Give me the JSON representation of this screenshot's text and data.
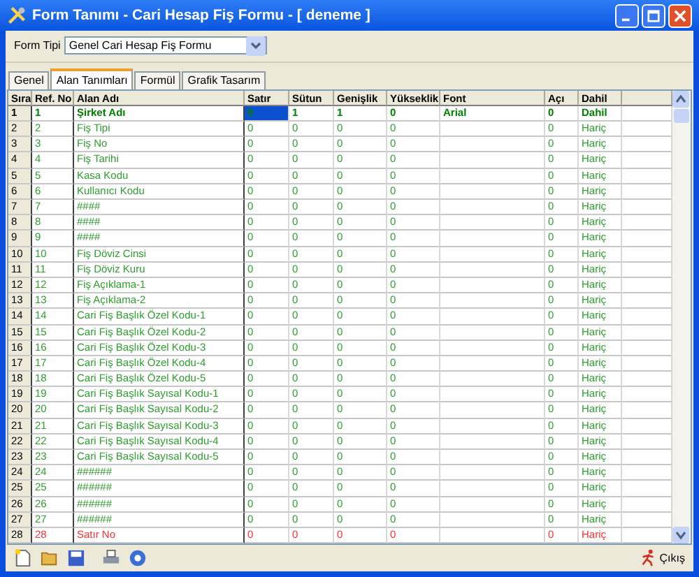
{
  "window": {
    "title": "Form Tanımı - Cari Hesap Fiş Formu - [ deneme ]"
  },
  "form_type": {
    "label": "Form Tipi",
    "value": "Genel Cari Hesap Fiş Formu"
  },
  "tabs": [
    {
      "label": "Genel",
      "selected": false
    },
    {
      "label": "Alan Tanımları",
      "selected": true
    },
    {
      "label": "Formül",
      "selected": false
    },
    {
      "label": "Grafik Tasarım",
      "selected": false
    }
  ],
  "table": {
    "columns": [
      "Sıra",
      "Ref. No",
      "Alan Adı",
      "Satır",
      "Sütun",
      "Genişlik",
      "Yükseklik",
      "Font",
      "Açı",
      "Dahil"
    ],
    "rows": [
      {
        "sira": "1",
        "ref": "1",
        "name": "Şirket Adı",
        "satir": "0",
        "sutun": "1",
        "genislik": "1",
        "yukseklik": "0",
        "font": "Arial",
        "aci": "0",
        "dahil": "Dahil",
        "bold": true,
        "selected": true,
        "color": "#008000"
      },
      {
        "sira": "2",
        "ref": "2",
        "name": "Fiş Tipi",
        "satir": "0",
        "sutun": "0",
        "genislik": "0",
        "yukseklik": "0",
        "aci": "0",
        "dahil": "Hariç",
        "bold": false,
        "selected": false,
        "color": "#2e9e2e"
      },
      {
        "sira": "3",
        "ref": "3",
        "name": "Fiş No",
        "satir": "0",
        "sutun": "0",
        "genislik": "0",
        "yukseklik": "0",
        "aci": "0",
        "dahil": "Hariç",
        "bold": false,
        "selected": false,
        "color": "#2e9e2e"
      },
      {
        "sira": "4",
        "ref": "4",
        "name": "Fiş Tarihi",
        "satir": "0",
        "sutun": "0",
        "genislik": "0",
        "yukseklik": "0",
        "aci": "0",
        "dahil": "Hariç",
        "bold": false,
        "selected": false,
        "color": "#2e9e2e"
      },
      {
        "sira": "5",
        "ref": "5",
        "name": "Kasa Kodu",
        "satir": "0",
        "sutun": "0",
        "genislik": "0",
        "yukseklik": "0",
        "aci": "0",
        "dahil": "Hariç",
        "bold": false,
        "selected": false,
        "color": "#2e9e2e"
      },
      {
        "sira": "6",
        "ref": "6",
        "name": "Kullanıcı Kodu",
        "satir": "0",
        "sutun": "0",
        "genislik": "0",
        "yukseklik": "0",
        "aci": "0",
        "dahil": "Hariç",
        "bold": false,
        "selected": false,
        "color": "#2e9e2e"
      },
      {
        "sira": "7",
        "ref": "7",
        "name": "####",
        "satir": "0",
        "sutun": "0",
        "genislik": "0",
        "yukseklik": "0",
        "aci": "0",
        "dahil": "Hariç",
        "bold": false,
        "selected": false,
        "color": "#2e9e2e"
      },
      {
        "sira": "8",
        "ref": "8",
        "name": "####",
        "satir": "0",
        "sutun": "0",
        "genislik": "0",
        "yukseklik": "0",
        "aci": "0",
        "dahil": "Hariç",
        "bold": false,
        "selected": false,
        "color": "#2e9e2e"
      },
      {
        "sira": "9",
        "ref": "9",
        "name": "####",
        "satir": "0",
        "sutun": "0",
        "genislik": "0",
        "yukseklik": "0",
        "aci": "0",
        "dahil": "Hariç",
        "bold": false,
        "selected": false,
        "color": "#2e9e2e"
      },
      {
        "sira": "10",
        "ref": "10",
        "name": "Fiş Döviz Cinsi",
        "satir": "0",
        "sutun": "0",
        "genislik": "0",
        "yukseklik": "0",
        "aci": "0",
        "dahil": "Hariç",
        "bold": false,
        "selected": false,
        "color": "#2e9e2e"
      },
      {
        "sira": "11",
        "ref": "11",
        "name": "Fiş Döviz Kuru",
        "satir": "0",
        "sutun": "0",
        "genislik": "0",
        "yukseklik": "0",
        "aci": "0",
        "dahil": "Hariç",
        "bold": false,
        "selected": false,
        "color": "#2e9e2e"
      },
      {
        "sira": "12",
        "ref": "12",
        "name": "Fiş Açıklama-1",
        "satir": "0",
        "sutun": "0",
        "genislik": "0",
        "yukseklik": "0",
        "aci": "0",
        "dahil": "Hariç",
        "bold": false,
        "selected": false,
        "color": "#2e9e2e"
      },
      {
        "sira": "13",
        "ref": "13",
        "name": "Fiş Açıklama-2",
        "satir": "0",
        "sutun": "0",
        "genislik": "0",
        "yukseklik": "0",
        "aci": "0",
        "dahil": "Hariç",
        "bold": false,
        "selected": false,
        "color": "#2e9e2e"
      },
      {
        "sira": "14",
        "ref": "14",
        "name": "Cari Fiş Başlık Özel Kodu-1",
        "satir": "0",
        "sutun": "0",
        "genislik": "0",
        "yukseklik": "0",
        "aci": "0",
        "dahil": "Hariç",
        "bold": false,
        "selected": false,
        "color": "#2e9e2e"
      },
      {
        "sira": "15",
        "ref": "15",
        "name": "Cari Fiş Başlık Özel Kodu-2",
        "satir": "0",
        "sutun": "0",
        "genislik": "0",
        "yukseklik": "0",
        "aci": "0",
        "dahil": "Hariç",
        "bold": false,
        "selected": false,
        "color": "#2e9e2e"
      },
      {
        "sira": "16",
        "ref": "16",
        "name": "Cari Fiş Başlık Özel Kodu-3",
        "satir": "0",
        "sutun": "0",
        "genislik": "0",
        "yukseklik": "0",
        "aci": "0",
        "dahil": "Hariç",
        "bold": false,
        "selected": false,
        "color": "#2e9e2e"
      },
      {
        "sira": "17",
        "ref": "17",
        "name": "Cari Fiş Başlık Özel Kodu-4",
        "satir": "0",
        "sutun": "0",
        "genislik": "0",
        "yukseklik": "0",
        "aci": "0",
        "dahil": "Hariç",
        "bold": false,
        "selected": false,
        "color": "#2e9e2e"
      },
      {
        "sira": "18",
        "ref": "18",
        "name": "Cari Fiş Başlık Özel Kodu-5",
        "satir": "0",
        "sutun": "0",
        "genislik": "0",
        "yukseklik": "0",
        "aci": "0",
        "dahil": "Hariç",
        "bold": false,
        "selected": false,
        "color": "#2e9e2e"
      },
      {
        "sira": "19",
        "ref": "19",
        "name": "Cari Fiş Başlık Sayısal Kodu-1",
        "satir": "0",
        "sutun": "0",
        "genislik": "0",
        "yukseklik": "0",
        "aci": "0",
        "dahil": "Hariç",
        "bold": false,
        "selected": false,
        "color": "#2e9e2e"
      },
      {
        "sira": "20",
        "ref": "20",
        "name": "Cari Fiş Başlık Sayısal Kodu-2",
        "satir": "0",
        "sutun": "0",
        "genislik": "0",
        "yukseklik": "0",
        "aci": "0",
        "dahil": "Hariç",
        "bold": false,
        "selected": false,
        "color": "#2e9e2e"
      },
      {
        "sira": "21",
        "ref": "21",
        "name": "Cari Fiş Başlık Sayısal Kodu-3",
        "satir": "0",
        "sutun": "0",
        "genislik": "0",
        "yukseklik": "0",
        "aci": "0",
        "dahil": "Hariç",
        "bold": false,
        "selected": false,
        "color": "#2e9e2e"
      },
      {
        "sira": "22",
        "ref": "22",
        "name": "Cari Fiş Başlık Sayısal Kodu-4",
        "satir": "0",
        "sutun": "0",
        "genislik": "0",
        "yukseklik": "0",
        "aci": "0",
        "dahil": "Hariç",
        "bold": false,
        "selected": false,
        "color": "#2e9e2e"
      },
      {
        "sira": "23",
        "ref": "23",
        "name": "Cari Fiş Başlık Sayısal Kodu-5",
        "satir": "0",
        "sutun": "0",
        "genislik": "0",
        "yukseklik": "0",
        "aci": "0",
        "dahil": "Hariç",
        "bold": false,
        "selected": false,
        "color": "#2e9e2e"
      },
      {
        "sira": "24",
        "ref": "24",
        "name": "######",
        "satir": "0",
        "sutun": "0",
        "genislik": "0",
        "yukseklik": "0",
        "aci": "0",
        "dahil": "Hariç",
        "bold": false,
        "selected": false,
        "color": "#2e9e2e"
      },
      {
        "sira": "25",
        "ref": "25",
        "name": "######",
        "satir": "0",
        "sutun": "0",
        "genislik": "0",
        "yukseklik": "0",
        "aci": "0",
        "dahil": "Hariç",
        "bold": false,
        "selected": false,
        "color": "#2e9e2e"
      },
      {
        "sira": "26",
        "ref": "26",
        "name": "######",
        "satir": "0",
        "sutun": "0",
        "genislik": "0",
        "yukseklik": "0",
        "aci": "0",
        "dahil": "Hariç",
        "bold": false,
        "selected": false,
        "color": "#2e9e2e"
      },
      {
        "sira": "27",
        "ref": "27",
        "name": "######",
        "satir": "0",
        "sutun": "0",
        "genislik": "0",
        "yukseklik": "0",
        "aci": "0",
        "dahil": "Hariç",
        "bold": false,
        "selected": false,
        "color": "#2e9e2e"
      },
      {
        "sira": "28",
        "ref": "28",
        "name": "Satır No",
        "satir": "0",
        "sutun": "0",
        "genislik": "0",
        "yukseklik": "0",
        "aci": "0",
        "dahil": "Hariç",
        "bold": false,
        "selected": false,
        "color": "#ff3030"
      }
    ]
  },
  "exit_button": {
    "label": "Çıkış"
  }
}
